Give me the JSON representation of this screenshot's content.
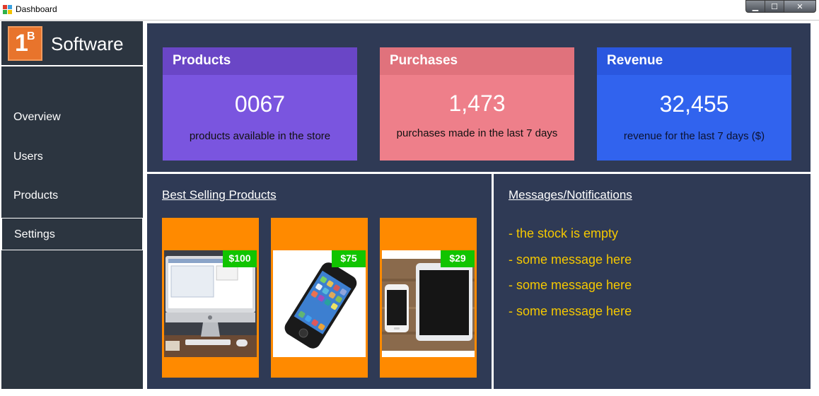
{
  "window": {
    "title": "Dashboard",
    "controls": {
      "minimize": "▁",
      "maximize": "☐",
      "close": "✕"
    }
  },
  "sidebar": {
    "logo_mark": {
      "big": "1",
      "small": "B"
    },
    "logo_name": "Software",
    "items": [
      {
        "label": "Overview",
        "active": false
      },
      {
        "label": "Users",
        "active": false
      },
      {
        "label": "Products",
        "active": false
      },
      {
        "label": "Settings",
        "active": true
      }
    ]
  },
  "stats": {
    "products": {
      "title": "Products",
      "value": "0067",
      "desc": "products available in the store"
    },
    "purchases": {
      "title": "Purchases",
      "value": "1,473",
      "desc": "purchases made in the last 7 days"
    },
    "revenue": {
      "title": "Revenue",
      "value": "32,455",
      "desc": "revenue for the last 7 days ($)"
    }
  },
  "best_selling": {
    "title": "Best Selling Products",
    "items": [
      {
        "price": "$100",
        "photo_icon": "desktop-computer-icon"
      },
      {
        "price": "$75",
        "photo_icon": "smartphone-icon"
      },
      {
        "price": "$29",
        "photo_icon": "tablet-and-phone-icon"
      }
    ]
  },
  "messages": {
    "title": "Messages/Notifications",
    "items": [
      "- the stock is empty",
      "- some message here",
      "- some message here",
      "- some message here"
    ]
  },
  "colors": {
    "sidebar_bg": "#2c3540",
    "main_bg": "#2f3a55",
    "products_card": "#7a55df",
    "purchases_card": "#ee7f8a",
    "revenue_card": "#3163ee",
    "tile_orange": "#ff8a00",
    "price_green": "#11c400",
    "message_yellow": "#f5c800"
  }
}
